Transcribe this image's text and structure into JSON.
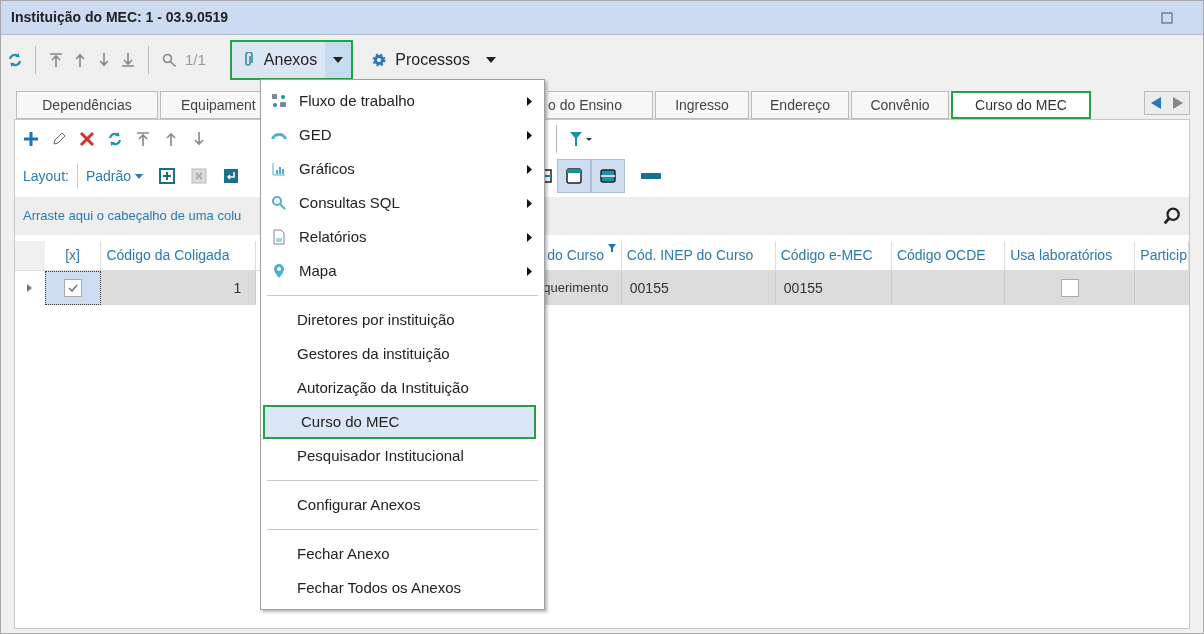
{
  "window": {
    "title": "Instituição do MEC: 1 - 03.9.0519"
  },
  "toolbar": {
    "page": "1/1",
    "buttons": [
      {
        "label": "Anexos",
        "open": true
      },
      {
        "label": "Processos",
        "open": false
      }
    ]
  },
  "tabs": [
    {
      "label": "Dependências",
      "selected": false
    },
    {
      "label": "Equipament",
      "selected": false
    },
    {
      "label": "o do Ensino",
      "selected": false
    },
    {
      "label": "Ingresso",
      "selected": false
    },
    {
      "label": "Endereço",
      "selected": false
    },
    {
      "label": "Convênio",
      "selected": false
    },
    {
      "label": "Curso do MEC",
      "selected": true
    }
  ],
  "layout": {
    "label": "Layout:",
    "value": "Padrão"
  },
  "group_hint": "Arraste aqui o cabeçalho de uma colu",
  "grid": {
    "columns": [
      "[x]",
      "Código da Coligada",
      "do Curso",
      "Cód. INEP do Curso",
      "Código e-MEC",
      "Código OCDE",
      "Usa laboratórios",
      "Particip"
    ],
    "rows": [
      {
        "checked": true,
        "coligada": "1",
        "column_3": "querimento",
        "inep": "00155",
        "emec": "00155",
        "usa_laboratorios": false
      }
    ]
  },
  "menu": {
    "items": [
      {
        "kind": "submenu",
        "label": "Fluxo de trabalho"
      },
      {
        "kind": "submenu",
        "label": "GED"
      },
      {
        "kind": "submenu",
        "label": "Gráficos"
      },
      {
        "kind": "submenu",
        "label": "Consultas SQL"
      },
      {
        "kind": "submenu",
        "label": "Relatórios"
      },
      {
        "kind": "submenu",
        "label": "Mapa"
      },
      {
        "kind": "separator"
      },
      {
        "kind": "item",
        "label": "Diretores por instituição",
        "selected": false
      },
      {
        "kind": "item",
        "label": "Gestores da instituição",
        "selected": false
      },
      {
        "kind": "item",
        "label": "Autorização da Instituição",
        "selected": false
      },
      {
        "kind": "item",
        "label": "Curso do MEC",
        "selected": true
      },
      {
        "kind": "item",
        "label": "Pesquisador Institucional",
        "selected": false
      },
      {
        "kind": "separator"
      },
      {
        "kind": "item",
        "label": "Configurar Anexos",
        "selected": false
      },
      {
        "kind": "separator"
      },
      {
        "kind": "item",
        "label": "Fechar Anexo",
        "selected": false
      },
      {
        "kind": "item",
        "label": "Fechar Todos os Anexos",
        "selected": false
      }
    ]
  }
}
